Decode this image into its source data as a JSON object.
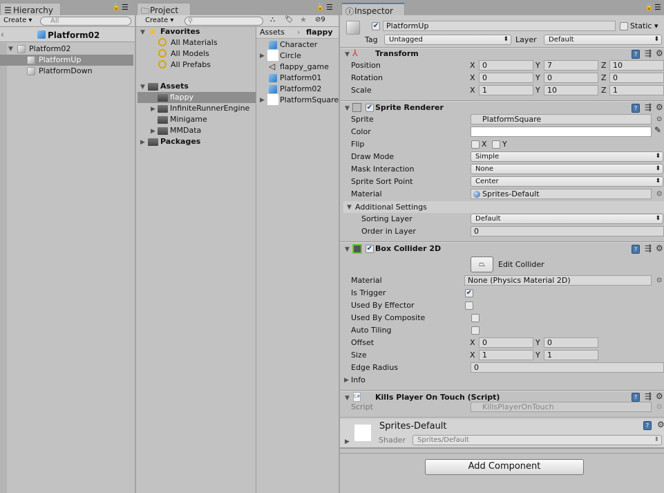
{
  "hierarchy": {
    "tab": "Hierarchy",
    "create": "Create",
    "search_placeholder": "All",
    "scene": "Platform02",
    "items": [
      {
        "label": "Platform02",
        "expanded": true
      },
      {
        "label": "PlatformUp",
        "selected": true
      },
      {
        "label": "PlatformDown"
      }
    ]
  },
  "project": {
    "tab": "Project",
    "create": "Create",
    "hidden_count": "9",
    "favorites": {
      "label": "Favorites",
      "items": [
        "All Materials",
        "All Models",
        "All Prefabs"
      ]
    },
    "assets": {
      "label": "Assets",
      "items": [
        {
          "label": "flappy",
          "selected": true
        },
        {
          "label": "InfiniteRunnerEngine"
        },
        {
          "label": "Minigame"
        },
        {
          "label": "MMData"
        }
      ]
    },
    "packages": "Packages",
    "breadcrumb": [
      "Assets",
      "flappy"
    ],
    "files": [
      "Character",
      "Circle",
      "flappy_game",
      "Platform01",
      "Platform02",
      "PlatformSquare"
    ]
  },
  "inspector": {
    "tab": "Inspector",
    "object_name": "PlatformUp",
    "active": true,
    "static_label": "Static",
    "tag_label": "Tag",
    "tag": "Untagged",
    "layer_label": "Layer",
    "layer": "Default",
    "transform": {
      "title": "Transform",
      "rows": [
        {
          "label": "Position",
          "x": "0",
          "y": "7",
          "z": "10"
        },
        {
          "label": "Rotation",
          "x": "0",
          "y": "0",
          "z": "0"
        },
        {
          "label": "Scale",
          "x": "1",
          "y": "10",
          "z": "1"
        }
      ]
    },
    "sprite_renderer": {
      "title": "Sprite Renderer",
      "sprite_label": "Sprite",
      "sprite": "PlatformSquare",
      "color_label": "Color",
      "color": "#ffffff",
      "flip_label": "Flip",
      "flip_x": "X",
      "flip_y": "Y",
      "draw_mode_label": "Draw Mode",
      "draw_mode": "Simple",
      "mask_label": "Mask Interaction",
      "mask": "None",
      "sort_point_label": "Sprite Sort Point",
      "sort_point": "Center",
      "material_label": "Material",
      "material": "Sprites-Default",
      "additional": "Additional Settings",
      "sorting_layer_label": "Sorting Layer",
      "sorting_layer": "Default",
      "order_label": "Order in Layer",
      "order": "0"
    },
    "box_collider": {
      "title": "Box Collider 2D",
      "edit_collider": "Edit Collider",
      "material_label": "Material",
      "material": "None (Physics Material 2D)",
      "is_trigger_label": "Is Trigger",
      "is_trigger": true,
      "effector_label": "Used By Effector",
      "composite_label": "Used By Composite",
      "auto_tiling_label": "Auto Tiling",
      "offset_label": "Offset",
      "offset_x": "0",
      "offset_y": "0",
      "size_label": "Size",
      "size_x": "1",
      "size_y": "1",
      "edge_radius_label": "Edge Radius",
      "edge_radius": "0",
      "info": "Info"
    },
    "script": {
      "title": "Kills Player On Touch (Script)",
      "script_label": "Script",
      "script": "KillsPlayerOnTouch"
    },
    "material_preview": {
      "name": "Sprites-Default",
      "shader_label": "Shader",
      "shader": "Sprites/Default"
    },
    "add_component": "Add Component"
  }
}
